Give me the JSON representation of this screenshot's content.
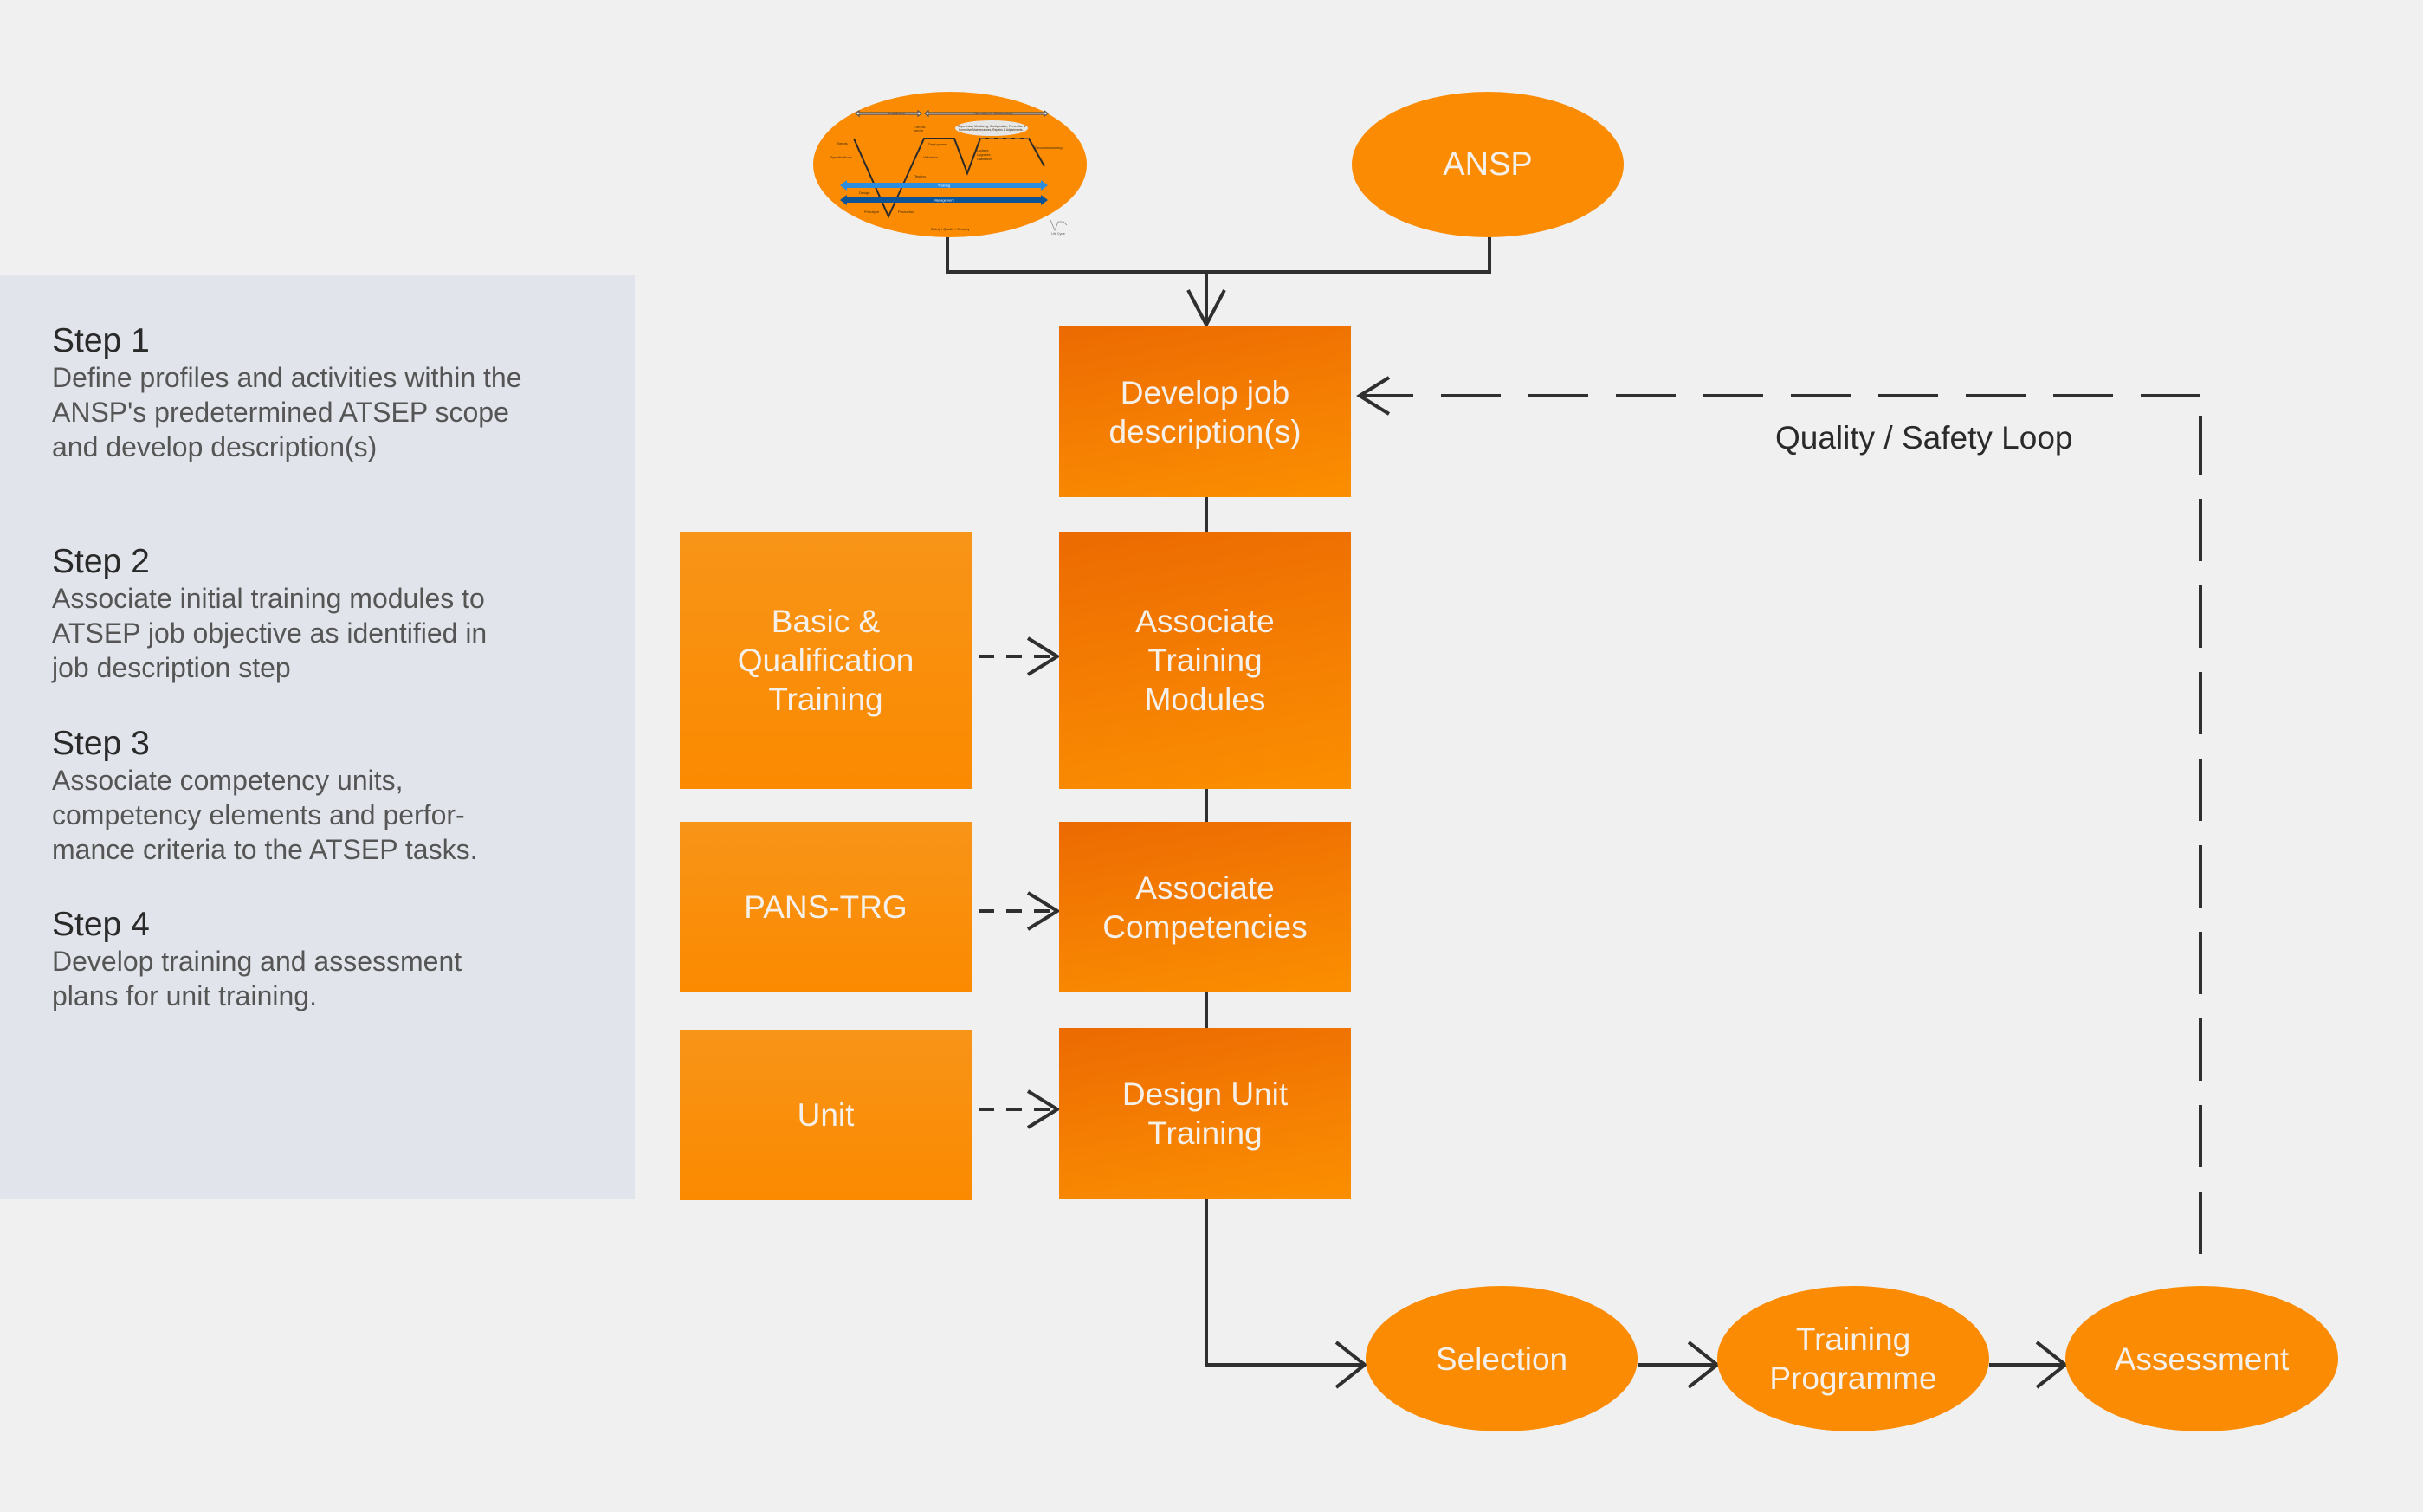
{
  "steps": [
    {
      "title": "Step 1",
      "body": "Define profiles and activities within the\nANSP's predetermined ATSEP scope\nand develop description(s)"
    },
    {
      "title": "Step 2",
      "body": "Associate initial training modules to\nATSEP job objective as identified in\njob description step"
    },
    {
      "title": "Step 3",
      "body": "Associate competency units,\ncompetency elements and perfor-\nmance criteria to the ATSEP tasks."
    },
    {
      "title": "Step 4",
      "body": "Develop training and assessment\nplans for unit training."
    }
  ],
  "top_nodes": {
    "lifecycle": {
      "label": "Life Cycle",
      "installation": "Installation",
      "operation": "Operation & Maintenance",
      "turn_into_service": "Turn into service",
      "supervision": "Supervision, Monitoring, Configuration, Preventive &\nCorrective Maintenances, Repairs & Adjustments...",
      "needs": "Needs",
      "specifications": "Specifications",
      "design": "Design",
      "prototype": "Prototype",
      "production": "Production",
      "testing": "Testing",
      "validation": "Validation",
      "deployment": "Deployment",
      "updates": "Updates\nUpgrades\nCalibration",
      "decommissioning": "Decommissioning",
      "training": "Training",
      "management": "Management",
      "safety": "Safety / Quality / Security"
    },
    "ansp": "ANSP"
  },
  "main_column": [
    {
      "label": "Develop job\ndescription(s)"
    },
    {
      "label": "Associate\nTraining\nModules"
    },
    {
      "label": "Associate\nCompetencies"
    },
    {
      "label": "Design Unit\nTraining"
    }
  ],
  "side_column": [
    {
      "label": "Basic &\nQualification\nTraining"
    },
    {
      "label": "PANS-TRG"
    },
    {
      "label": "Unit"
    }
  ],
  "bottom_flow": [
    {
      "label": "Selection"
    },
    {
      "label": "Training\nProgramme"
    },
    {
      "label": "Assessment"
    }
  ],
  "loop_label": "Quality / Safety Loop",
  "colors": {
    "background": "#f0f0f0",
    "panel": "#e1e5eb",
    "orange": "#fa8b03",
    "orange_dark": "#ec6a02",
    "line": "#2f2f2f",
    "training_arrow": "#2a8de0",
    "management_arrow": "#0b5394"
  }
}
